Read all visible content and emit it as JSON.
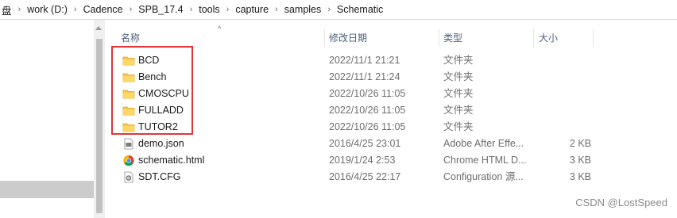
{
  "address_bar": {
    "crumbs": [
      "盘",
      "work (D:)",
      "Cadence",
      "SPB_17.4",
      "tools",
      "capture",
      "samples",
      "Schematic"
    ],
    "separator": "›"
  },
  "columns": {
    "name": "名称",
    "date": "修改日期",
    "type": "类型",
    "size": "大小"
  },
  "files": [
    {
      "name": "BCD",
      "date": "2022/11/1 21:21",
      "type": "文件夹",
      "size": "",
      "icon": "folder-icon"
    },
    {
      "name": "Bench",
      "date": "2022/11/1 21:24",
      "type": "文件夹",
      "size": "",
      "icon": "folder-icon"
    },
    {
      "name": "CMOSCPU",
      "date": "2022/10/26 11:05",
      "type": "文件夹",
      "size": "",
      "icon": "folder-icon"
    },
    {
      "name": "FULLADD",
      "date": "2022/10/26 11:05",
      "type": "文件夹",
      "size": "",
      "icon": "folder-icon"
    },
    {
      "name": "TUTOR2",
      "date": "2022/10/26 11:05",
      "type": "文件夹",
      "size": "",
      "icon": "folder-icon"
    },
    {
      "name": "demo.json",
      "date": "2016/4/25 23:01",
      "type": "Adobe After Effe...",
      "size": "2 KB",
      "icon": "json-file-icon"
    },
    {
      "name": "schematic.html",
      "date": "2019/1/24 2:53",
      "type": "Chrome HTML D...",
      "size": "3 KB",
      "icon": "chrome-icon"
    },
    {
      "name": "SDT.CFG",
      "date": "2016/4/25 22:17",
      "type": "Configuration 源...",
      "size": "3 KB",
      "icon": "config-file-icon"
    }
  ],
  "watermark": "CSDN @LostSpeed",
  "colors": {
    "folder": "#f8c94a",
    "highlight_box": "#e0363a",
    "header_text": "#4c607a",
    "nav_selected": "#cccccc"
  }
}
